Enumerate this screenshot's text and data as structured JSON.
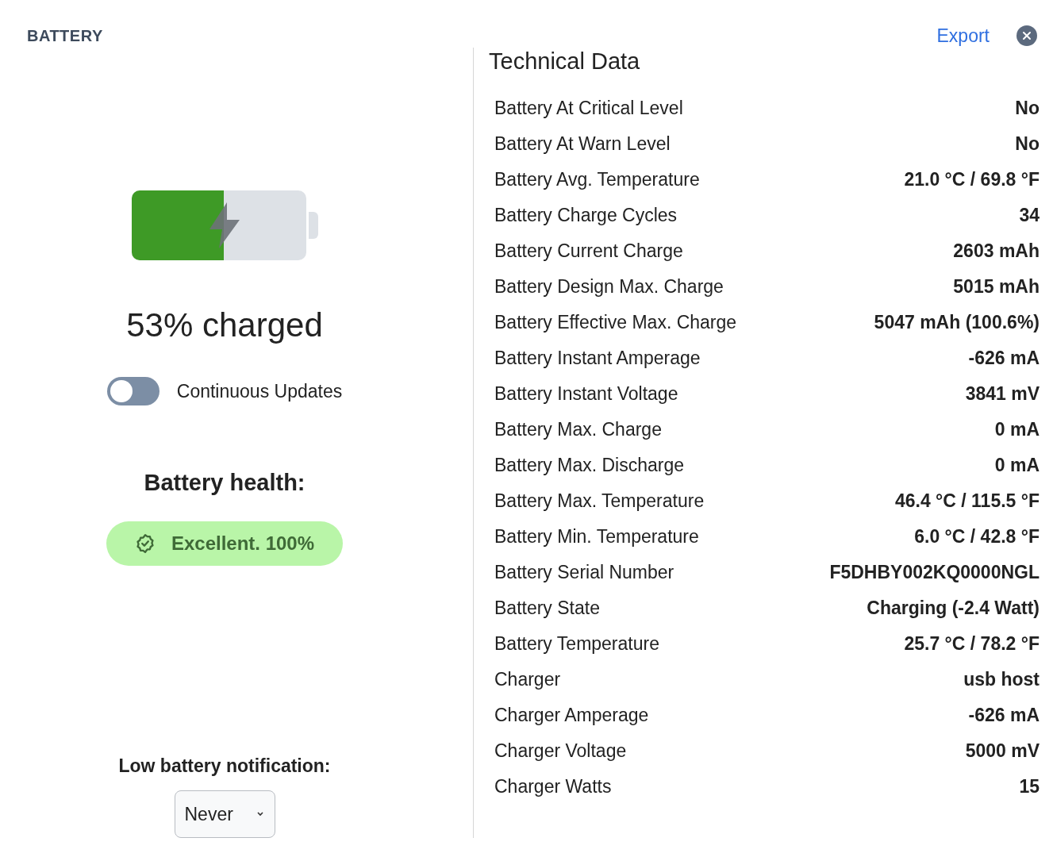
{
  "header": {
    "title": "BATTERY",
    "export_label": "Export"
  },
  "battery": {
    "level": 0.53,
    "charging": true,
    "status": "53% charged"
  },
  "continuous_updates": {
    "label": "Continuous Updates",
    "on": false
  },
  "health": {
    "heading": "Battery health:",
    "value": "Excellent. 100%"
  },
  "notification": {
    "label": "Low battery notification:",
    "value": "Never"
  },
  "technical": {
    "title": "Technical Data",
    "rows": [
      {
        "label": "Battery At Critical Level",
        "value": "No"
      },
      {
        "label": "Battery At Warn Level",
        "value": "No"
      },
      {
        "label": "Battery Avg. Temperature",
        "value": "21.0 °C / 69.8 °F"
      },
      {
        "label": "Battery Charge Cycles",
        "value": "34"
      },
      {
        "label": "Battery Current Charge",
        "value": "2603 mAh"
      },
      {
        "label": "Battery Design Max. Charge",
        "value": "5015 mAh"
      },
      {
        "label": "Battery Effective Max. Charge",
        "value": "5047 mAh (100.6%)"
      },
      {
        "label": "Battery Instant Amperage",
        "value": "-626 mA"
      },
      {
        "label": "Battery Instant Voltage",
        "value": "3841 mV"
      },
      {
        "label": "Battery Max. Charge",
        "value": "0 mA"
      },
      {
        "label": "Battery Max. Discharge",
        "value": "0 mA"
      },
      {
        "label": "Battery Max. Temperature",
        "value": "46.4 °C / 115.5 °F"
      },
      {
        "label": "Battery Min. Temperature",
        "value": "6.0 °C / 42.8 °F"
      },
      {
        "label": "Battery Serial Number",
        "value": "F5DHBY002KQ0000NGL"
      },
      {
        "label": "Battery State",
        "value": "Charging (-2.4 Watt)"
      },
      {
        "label": "Battery Temperature",
        "value": "25.7 °C / 78.2 °F"
      },
      {
        "label": "Charger",
        "value": "usb host"
      },
      {
        "label": "Charger Amperage",
        "value": "-626 mA"
      },
      {
        "label": "Charger Voltage",
        "value": "5000 mV"
      },
      {
        "label": "Charger Watts",
        "value": "15"
      }
    ]
  }
}
